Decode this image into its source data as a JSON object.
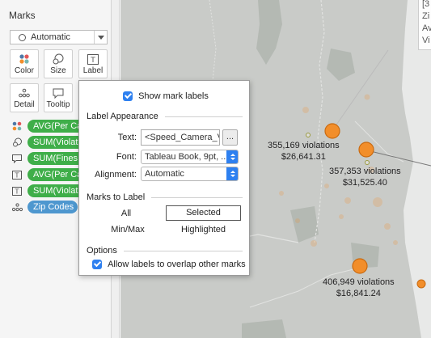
{
  "marks_card": {
    "title": "Marks",
    "mark_type": "Automatic",
    "buttons": [
      {
        "label": "Color",
        "icon": "color-icon"
      },
      {
        "label": "Size",
        "icon": "size-icon"
      },
      {
        "label": "Label",
        "icon": "label-icon"
      },
      {
        "label": "Detail",
        "icon": "detail-icon"
      },
      {
        "label": "Tooltip",
        "icon": "tooltip-icon"
      }
    ],
    "pills": [
      {
        "label": "AVG(Per Ca",
        "icon": "color-icon"
      },
      {
        "label": "SUM(Violat",
        "icon": "size-icon"
      },
      {
        "label": "SUM(Fines",
        "icon": "tooltip-icon"
      },
      {
        "label": "AVG(Per Ca",
        "icon": "label-icon"
      },
      {
        "label": "SUM(Violat",
        "icon": "label-icon"
      },
      {
        "label": "Zip Codes",
        "icon": "detail-icon"
      }
    ]
  },
  "dialog": {
    "show_mark_labels": "Show mark labels",
    "label_appearance": "Label Appearance",
    "text_label": "Text:",
    "text_value": "<Speed_Camera_Vio",
    "more_button": "...",
    "font_label": "Font:",
    "font_value": "Tableau Book, 9pt, ..",
    "alignment_label": "Alignment:",
    "alignment_value": "Automatic",
    "marks_to_label": "Marks to Label",
    "all": "All",
    "selected": "Selected",
    "min_max": "Min/Max",
    "highlighted": "Highlighted",
    "options": "Options",
    "allow_overlap": "Allow labels to overlap other marks"
  },
  "map": {
    "tooltip_lines": [
      "[3",
      "Zi",
      "Av",
      "Vi"
    ],
    "labels": [
      {
        "violations": "355,169 violations",
        "fines": "$26,641.31"
      },
      {
        "violations": "357,353 violations",
        "fines": "$31,525.40"
      },
      {
        "violations": "406,949 violations",
        "fines": "$16,841.24"
      }
    ],
    "colors": {
      "mark": "#f28e2b",
      "land": "#c9cbc8",
      "water": "#e8e9e8",
      "park": "#b4b9b3"
    }
  }
}
